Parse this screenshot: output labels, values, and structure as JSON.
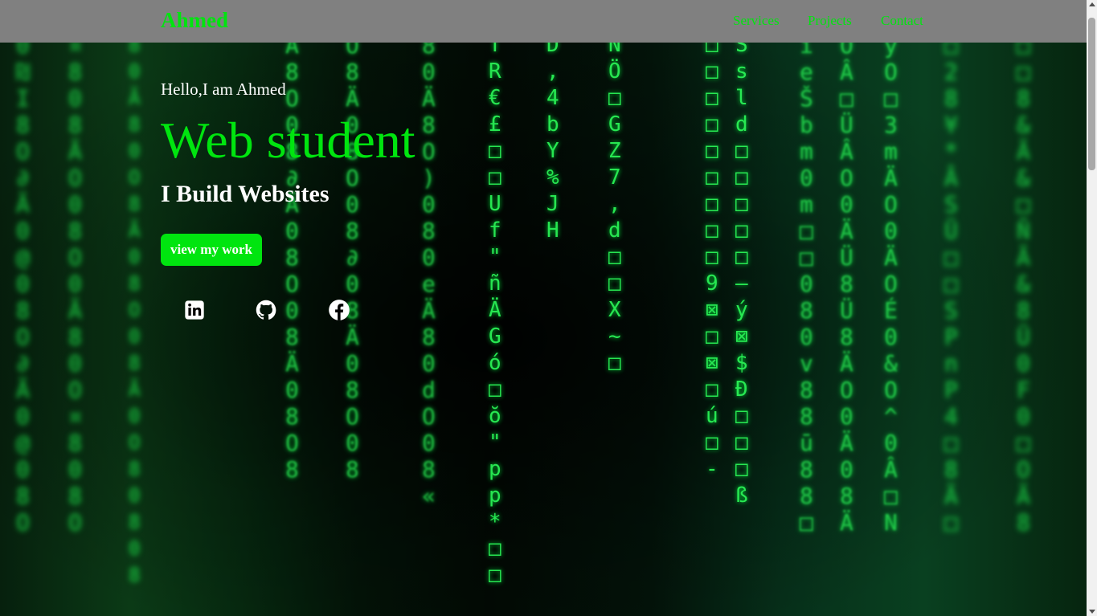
{
  "nav": {
    "brand": "Ahmed",
    "links": [
      "Services",
      "Projects",
      "Contact"
    ]
  },
  "hero": {
    "greeting": "Hello,I am Ahmed",
    "role": "Web student",
    "tagline": "I Build Websites",
    "cta_label": "view my work"
  },
  "social": {
    "icons": [
      "linkedin-icon",
      "github-icon",
      "facebook-icon"
    ]
  },
  "colors": {
    "accent": "#00e50f",
    "navbar": "#808080",
    "text": "#ffffff"
  }
}
